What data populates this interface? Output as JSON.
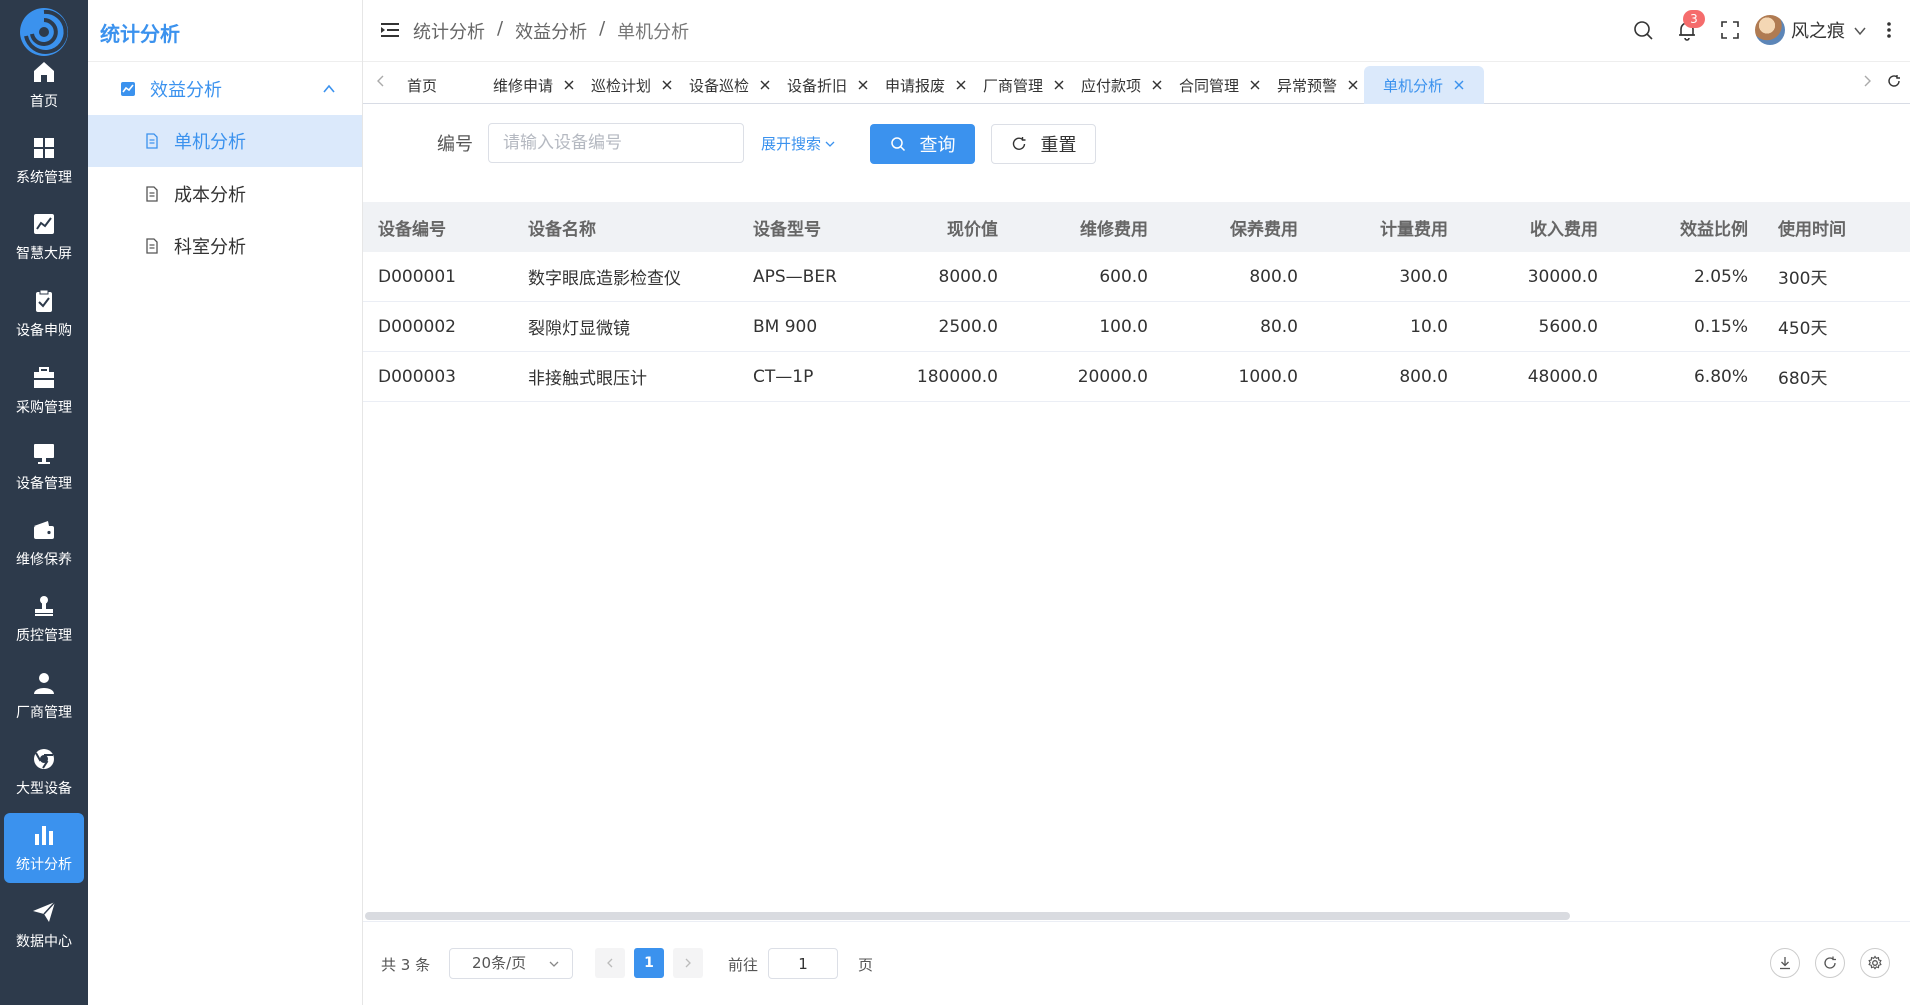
{
  "rail": {
    "items": [
      {
        "label": "首页",
        "icon": "home-icon"
      },
      {
        "label": "系统管理",
        "icon": "grid-icon"
      },
      {
        "label": "智慧大屏",
        "icon": "chart-line-icon"
      },
      {
        "label": "设备申购",
        "icon": "clipboard-check-icon"
      },
      {
        "label": "采购管理",
        "icon": "briefcase-icon"
      },
      {
        "label": "设备管理",
        "icon": "monitor-icon"
      },
      {
        "label": "维修保养",
        "icon": "wallet-icon"
      },
      {
        "label": "质控管理",
        "icon": "stamp-icon"
      },
      {
        "label": "厂商管理",
        "icon": "user-icon"
      },
      {
        "label": "大型设备",
        "icon": "chrome-icon"
      },
      {
        "label": "统计分析",
        "icon": "bar-chart-icon",
        "active": true
      },
      {
        "label": "数据中心",
        "icon": "paper-plane-icon"
      }
    ]
  },
  "submenu": {
    "title": "统计分析",
    "group": "效益分析",
    "items": [
      "单机分析",
      "成本分析",
      "科室分析"
    ],
    "active_item": "单机分析"
  },
  "header": {
    "breadcrumb": [
      "统计分析",
      "效益分析",
      "单机分析"
    ],
    "notification_count": "3",
    "username": "风之痕"
  },
  "tabs": [
    {
      "label": "首页",
      "closable": false
    },
    {
      "label": "维修申请",
      "closable": true
    },
    {
      "label": "巡检计划",
      "closable": true
    },
    {
      "label": "设备巡检",
      "closable": true
    },
    {
      "label": "设备折旧",
      "closable": true
    },
    {
      "label": "申请报废",
      "closable": true
    },
    {
      "label": "厂商管理",
      "closable": true
    },
    {
      "label": "应付款项",
      "closable": true
    },
    {
      "label": "合同管理",
      "closable": true
    },
    {
      "label": "异常预警",
      "closable": true
    },
    {
      "label": "单机分析",
      "closable": true,
      "active": true
    }
  ],
  "search": {
    "code_label": "编号",
    "code_placeholder": "请输入设备编号",
    "expand_label": "展开搜索",
    "query_label": "查询",
    "reset_label": "重置"
  },
  "table": {
    "columns": [
      "设备编号",
      "设备名称",
      "设备型号",
      "现价值",
      "维修费用",
      "保养费用",
      "计量费用",
      "收入费用",
      "效益比例",
      "使用时间"
    ],
    "rows": [
      [
        "D000001",
        "数字眼底造影检查仪",
        "APS—BER",
        "8000.0",
        "600.0",
        "800.0",
        "300.0",
        "30000.0",
        "2.05%",
        "300天"
      ],
      [
        "D000002",
        "裂隙灯显微镜",
        "BM 900",
        "2500.0",
        "100.0",
        "80.0",
        "10.0",
        "5600.0",
        "0.15%",
        "450天"
      ],
      [
        "D000003",
        "非接触式眼压计",
        "CT—1P",
        "180000.0",
        "20000.0",
        "1000.0",
        "800.0",
        "48000.0",
        "6.80%",
        "680天"
      ]
    ]
  },
  "pagination": {
    "total": "共 3 条",
    "page_size": "20条/页",
    "current_page": "1",
    "goto_label": "前往",
    "goto_value": "1",
    "page_unit": "页"
  },
  "colors": {
    "primary": "#3b92ee",
    "rail_bg": "#2d3a4b",
    "active_bg": "#dbe9fb",
    "badge": "#f56c6c"
  }
}
